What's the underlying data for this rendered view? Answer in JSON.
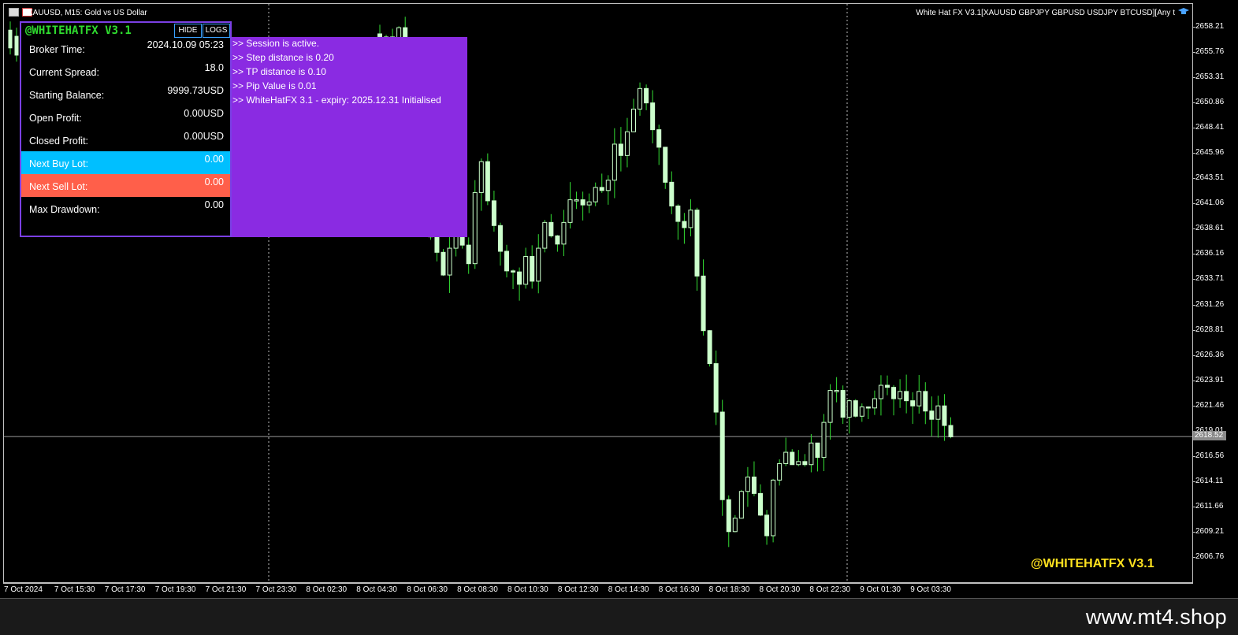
{
  "window": {
    "symbol_title": "XAUUSD, M15:  Gold vs US Dollar",
    "ea_title": "White Hat FX V3.1[XAUUSD GBPJPY GBPUSD USDJPY BTCUSD][Any t"
  },
  "watermark": "@WHITEHATFX V3.1",
  "footer": {
    "site": "www.mt4.shop"
  },
  "panel": {
    "brand": "@WHITEHATFX V3.1",
    "hide_label": "HIDE",
    "logs_label": "LOGS",
    "rows": [
      {
        "label": "Broker Time:",
        "value": "2024.10.09 05:23"
      },
      {
        "label": "Current Spread:",
        "value": "18.0"
      },
      {
        "label": "Starting Balance:",
        "value": "9999.73USD"
      },
      {
        "label": "Open Profit:",
        "value": "0.00USD"
      },
      {
        "label": "Closed Profit:",
        "value": "0.00USD"
      },
      {
        "label": "Next Buy Lot:",
        "value": "0.00"
      },
      {
        "label": "Next Sell Lot:",
        "value": "0.00"
      },
      {
        "label": "Max Drawdown:",
        "value": "0.00"
      }
    ],
    "colors": {
      "border": "#7b3fe4",
      "buy_row": "#00bfff",
      "sell_row": "#ff5f4a",
      "brand": "#2fdc2f"
    }
  },
  "logs": [
    ">> Session is active.",
    ">> Step distance is 0.20",
    ">> TP distance is 0.10",
    ">> Pip Value is 0.01",
    ">> WhiteHatFX 3.1 - expiry: 2025.12.31 Initialised"
  ],
  "chart_data": {
    "type": "candlestick",
    "symbol": "XAUUSD",
    "timeframe": "M15",
    "current_price": 2618.52,
    "current_price_label": "2618.52",
    "y_ticks": [
      "2658.21",
      "2655.76",
      "2653.31",
      "2650.86",
      "2648.41",
      "2645.96",
      "2643.51",
      "2641.06",
      "2638.61",
      "2636.16",
      "2633.71",
      "2631.26",
      "2628.81",
      "2626.36",
      "2623.91",
      "2621.46",
      "2619.01",
      "2616.56",
      "2614.11",
      "2611.66",
      "2609.21",
      "2606.76"
    ],
    "x_ticks": [
      "7 Oct 2024",
      "7 Oct 15:30",
      "7 Oct 17:30",
      "7 Oct 19:30",
      "7 Oct 21:30",
      "7 Oct 23:30",
      "8 Oct 02:30",
      "8 Oct 04:30",
      "8 Oct 06:30",
      "8 Oct 08:30",
      "8 Oct 10:30",
      "8 Oct 12:30",
      "8 Oct 14:30",
      "8 Oct 16:30",
      "8 Oct 18:30",
      "8 Oct 20:30",
      "8 Oct 22:30",
      "9 Oct 01:30",
      "9 Oct 03:30"
    ],
    "candle_color": "#ccffcc",
    "wick_color": "#33dd33",
    "closes": [
      2656.4,
      2657.3,
      2655.8,
      2658.2,
      2656.0,
      2655.2,
      2652.6,
      2640.5,
      2637.9,
      2636.4,
      2634.2,
      2636.8,
      2639.5,
      2637.1,
      2635.3,
      2642.2,
      2645.2,
      2641.4,
      2639.0,
      2636.5,
      2634.6,
      2634.5,
      2633.3,
      2636.0,
      2633.6,
      2636.8,
      2639.3,
      2638.0,
      2637.2,
      2639.3,
      2641.5,
      2641.5,
      2641.0,
      2641.3,
      2642.7,
      2642.4,
      2643.4,
      2646.9,
      2645.8,
      2648.1,
      2650.3,
      2652.3,
      2650.9,
      2648.3,
      2646.6,
      2643.2,
      2640.9,
      2639.4,
      2638.8,
      2640.5,
      2634.1,
      2628.8,
      2625.6,
      2620.9,
      2612.4,
      2609.3,
      2610.6,
      2613.2,
      2614.6,
      2613.0,
      2610.9,
      2608.9,
      2614.3,
      2615.9,
      2617.0,
      2615.8,
      2616.1,
      2615.8,
      2617.9,
      2616.5,
      2619.9,
      2623.0,
      2623.0,
      2620.4,
      2622.0,
      2620.5,
      2621.4,
      2621.3,
      2622.2,
      2623.5,
      2623.3,
      2622.2,
      2622.9,
      2622.0,
      2621.5,
      2622.9,
      2621.0,
      2620.2,
      2621.5,
      2619.6,
      2618.5
    ]
  }
}
